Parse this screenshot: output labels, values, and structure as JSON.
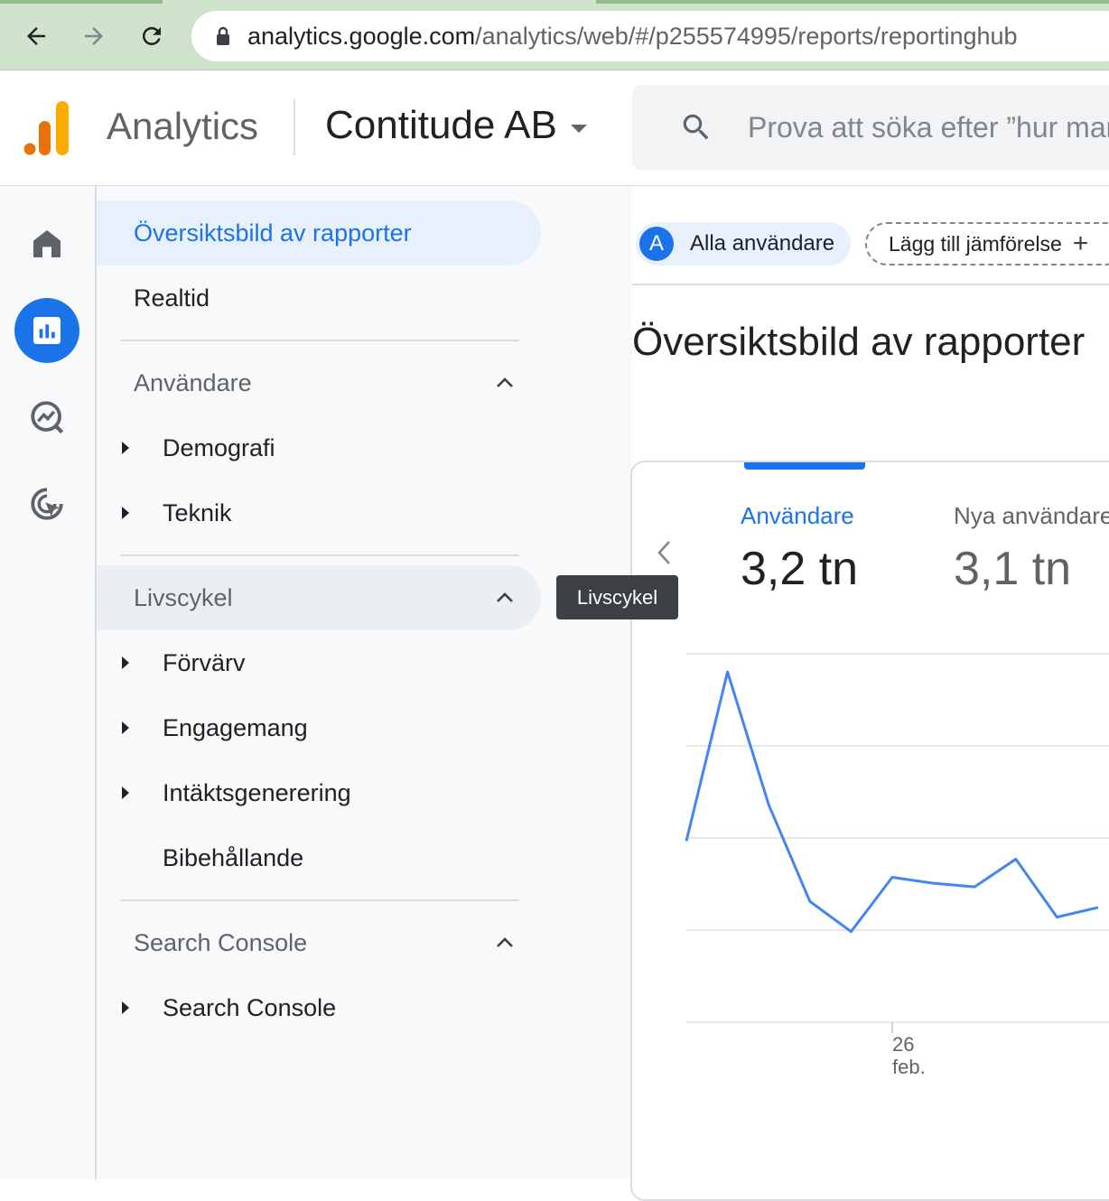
{
  "browser": {
    "url_domain": "analytics.google.com",
    "url_path": "/analytics/web/#/p255574995/reports/reportinghub"
  },
  "header": {
    "app_name": "Analytics",
    "account_name": "Contitude AB",
    "search_placeholder": "Prova att söka efter ”hur man"
  },
  "rail": {
    "items": [
      "home-icon",
      "reports-icon",
      "explore-icon",
      "advertising-icon"
    ],
    "active": 1
  },
  "nav": {
    "overview": "Översiktsbild av rapporter",
    "realtime": "Realtid",
    "sections": [
      {
        "title": "Användare",
        "items": [
          {
            "label": "Demografi",
            "expandable": true
          },
          {
            "label": "Teknik",
            "expandable": true
          }
        ]
      },
      {
        "title": "Livscykel",
        "items": [
          {
            "label": "Förvärv",
            "expandable": true
          },
          {
            "label": "Engagemang",
            "expandable": true
          },
          {
            "label": "Intäktsgenerering",
            "expandable": true
          },
          {
            "label": "Bibehållande",
            "expandable": false
          }
        ]
      },
      {
        "title": "Search Console",
        "items": [
          {
            "label": "Search Console",
            "expandable": true
          }
        ]
      }
    ]
  },
  "tooltip": {
    "text": "Livscykel"
  },
  "main": {
    "segment_avatar": "A",
    "segment_label": "Alla användare",
    "compare_label": "Lägg till jämförelse",
    "page_title": "Översiktsbild av rapporter"
  },
  "metrics": [
    {
      "label": "Användare",
      "value": "3,2 tn",
      "active": true
    },
    {
      "label": "Nya användare",
      "value": "3,1 tn",
      "active": false
    }
  ],
  "colors": {
    "accent": "#1a73e8",
    "line": "#4285f4",
    "nav_selected_bg": "#e8f0fe"
  },
  "chart_data": {
    "type": "line",
    "x_tick_labels": [
      {
        "day": "26",
        "month": "feb."
      }
    ],
    "series": [
      {
        "values": [
          2.3,
          3.7,
          2.6,
          1.8,
          1.55,
          2.0,
          1.95,
          1.92,
          2.15,
          1.67,
          1.75
        ]
      }
    ],
    "ylim": [
      0.8,
      3.85
    ],
    "grid": true
  }
}
